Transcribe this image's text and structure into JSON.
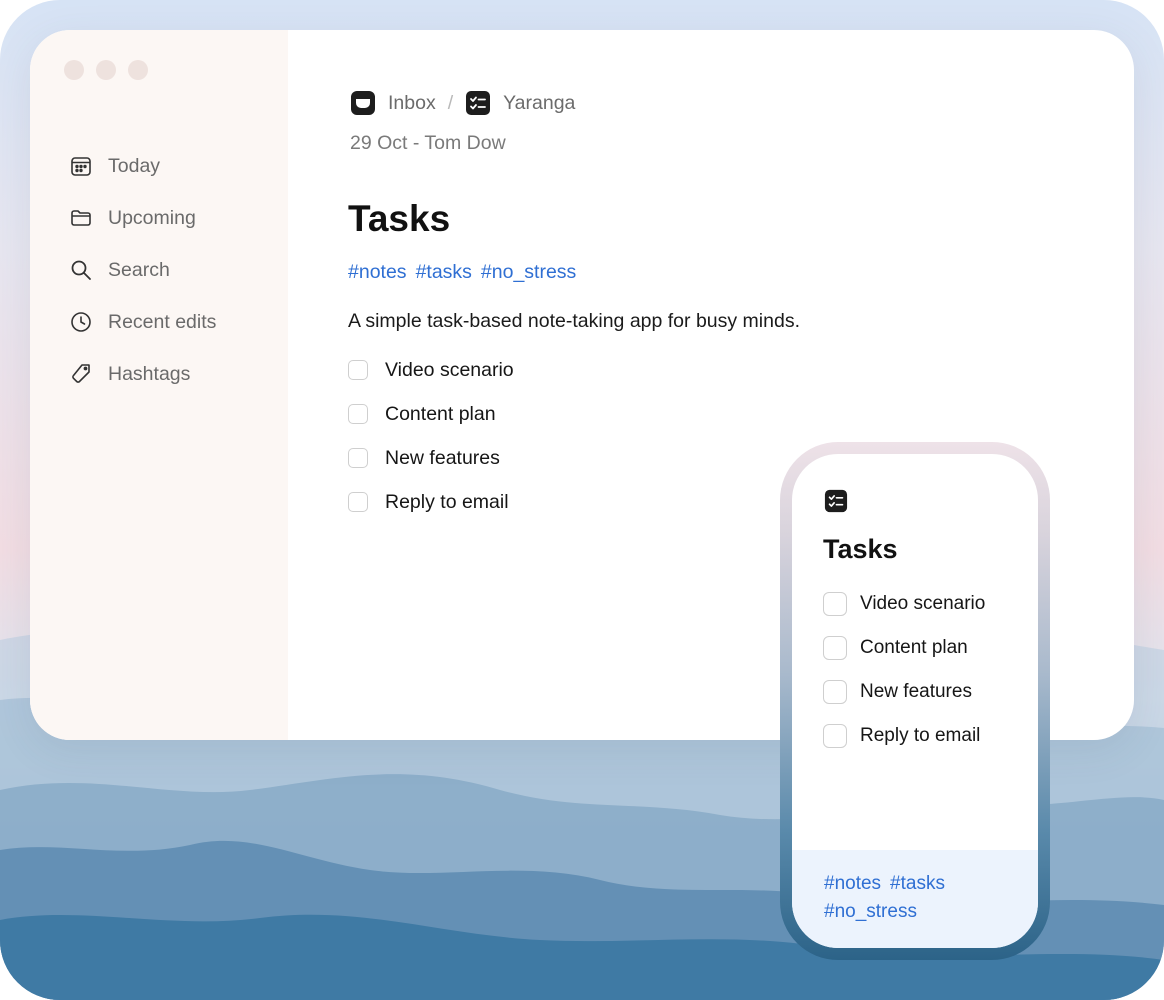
{
  "sidebar": {
    "items": [
      {
        "label": "Today",
        "icon": "calendar-icon"
      },
      {
        "label": "Upcoming",
        "icon": "folder-icon"
      },
      {
        "label": "Search",
        "icon": "search-icon"
      },
      {
        "label": "Recent edits",
        "icon": "clock-icon"
      },
      {
        "label": "Hashtags",
        "icon": "tag-icon"
      }
    ]
  },
  "breadcrumb": {
    "inbox": "Inbox",
    "separator": "/",
    "project": "Yaranga"
  },
  "note": {
    "meta": "29 Oct - Tom Dow",
    "title": "Tasks",
    "tags": [
      "#notes",
      "#tasks",
      "#no_stress"
    ],
    "description": "A simple task-based note-taking app for busy minds.",
    "tasks": [
      "Video scenario",
      "Content plan",
      "New features",
      "Reply to email"
    ]
  },
  "mobile": {
    "title": "Tasks",
    "tasks": [
      "Video scenario",
      "Content plan",
      "New features",
      "Reply to email"
    ],
    "tags": [
      "#notes",
      "#tasks",
      "#no_stress"
    ]
  },
  "colors": {
    "accent": "#2f6fd3",
    "sidebar_bg": "#fcf7f4",
    "mobile_footer_bg": "#ecf3fd"
  }
}
